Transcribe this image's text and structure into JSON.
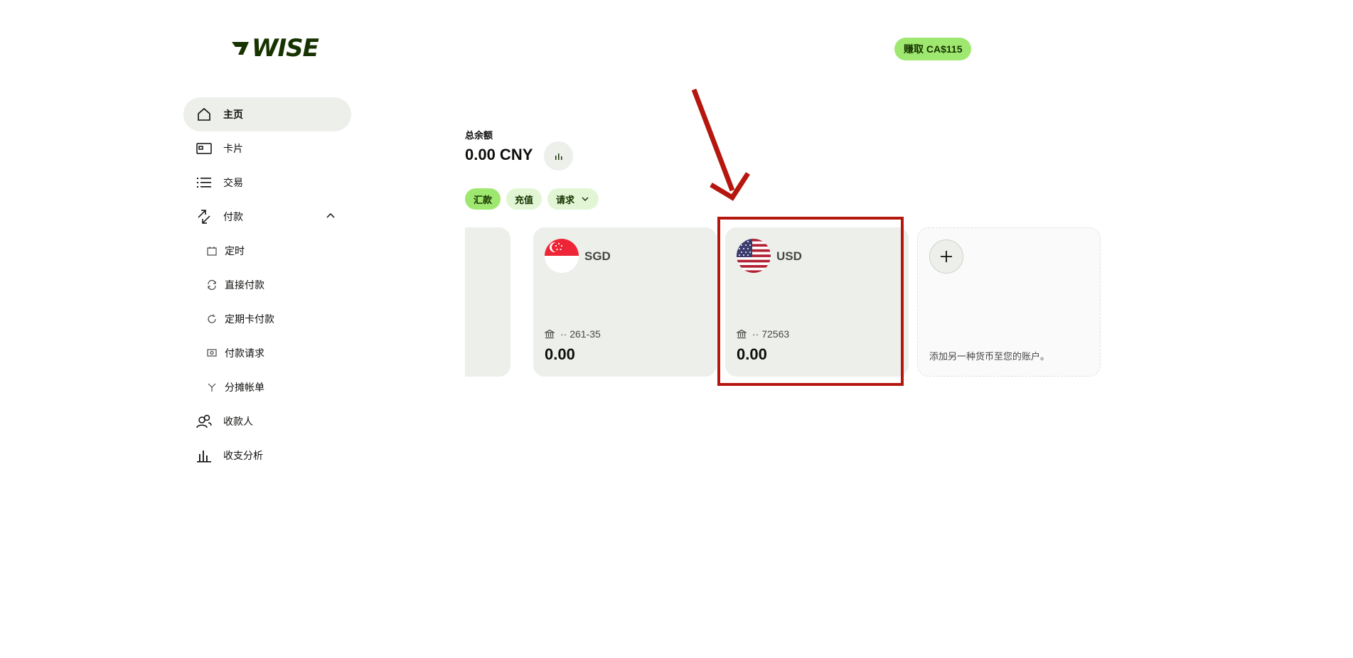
{
  "brand": {
    "logo_text": "WISE",
    "logo_color": "#163300"
  },
  "header": {
    "earn_label": "赚取 CA$115"
  },
  "sidebar": {
    "items": [
      {
        "label": "主页",
        "icon": "home-icon",
        "active": true
      },
      {
        "label": "卡片",
        "icon": "card-icon"
      },
      {
        "label": "交易",
        "icon": "list-icon"
      },
      {
        "label": "付款",
        "icon": "payments-icon",
        "expanded": true
      }
    ],
    "sub_items": [
      {
        "label": "定时",
        "icon": "calendar-icon"
      },
      {
        "label": "直接付款",
        "icon": "refresh-icon"
      },
      {
        "label": "定期卡付款",
        "icon": "repeat-icon"
      },
      {
        "label": "付款请求",
        "icon": "request-icon"
      },
      {
        "label": "分摊帐单",
        "icon": "split-icon"
      }
    ],
    "bottom_items": [
      {
        "label": "收款人",
        "icon": "recipients-icon"
      },
      {
        "label": "收支分析",
        "icon": "bar-chart-icon"
      }
    ]
  },
  "balance": {
    "label": "总余额",
    "value": "0.00 CNY"
  },
  "actions": {
    "send": "汇款",
    "add": "充值",
    "request": "请求"
  },
  "accounts": [
    {
      "currency": "SGD",
      "account_number": "·· 261-35",
      "amount": "0.00",
      "flag": "sg-flag-icon"
    },
    {
      "currency": "USD",
      "account_number": "·· 72563",
      "amount": "0.00",
      "flag": "us-flag-icon",
      "highlighted": true
    }
  ],
  "add_currency": {
    "text": "添加另一种货币至您的账户。"
  },
  "colors": {
    "accent": "#9fe870",
    "accent_light": "#e2f6d5",
    "card_bg": "#edefeb",
    "annotation": "#b5170f"
  }
}
